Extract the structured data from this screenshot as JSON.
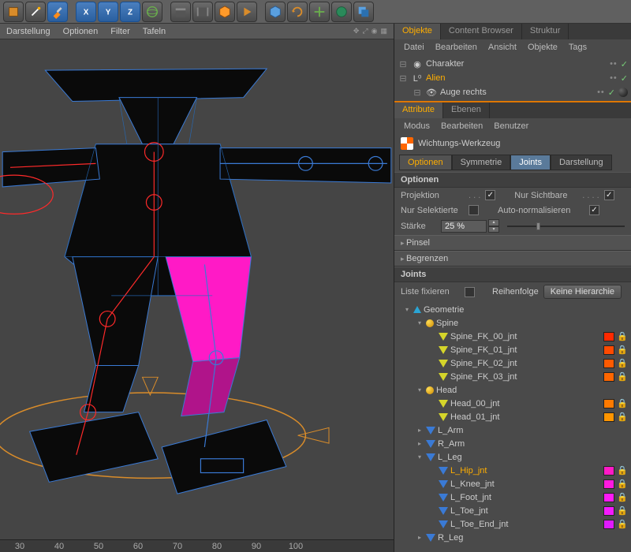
{
  "toolbar_icons": [
    "cube",
    "wand",
    "brush",
    "axis-x",
    "axis-y",
    "axis-z",
    "world",
    "clapper",
    "film",
    "orange-cube",
    "play",
    "blue-cube",
    "cycle",
    "arrows",
    "globe",
    "layers"
  ],
  "view_menu": {
    "items": [
      "Darstellung",
      "Optionen",
      "Filter",
      "Tafeln"
    ]
  },
  "ruler": [
    "30",
    "40",
    "50",
    "60",
    "70",
    "80",
    "90",
    "100"
  ],
  "right_tabs": {
    "items": [
      "Objekte",
      "Content Browser",
      "Struktur"
    ],
    "active": 0
  },
  "obj_menubar": [
    "Datei",
    "Bearbeiten",
    "Ansicht",
    "Objekte",
    "Tags"
  ],
  "object_manager": [
    {
      "indent": 0,
      "icon": "char",
      "label": "Charakter"
    },
    {
      "indent": 0,
      "icon": "null",
      "label": "Alien",
      "sel": true
    },
    {
      "indent": 1,
      "icon": "eye",
      "label": "Auge rechts",
      "material": true
    }
  ],
  "attr_tabs": {
    "items": [
      "Attribute",
      "Ebenen"
    ],
    "active": 0
  },
  "attr_menubar": [
    "Modus",
    "Bearbeiten",
    "Benutzer"
  ],
  "tool_name": "Wichtungs-Werkzeug",
  "mode_tabs": [
    "Optionen",
    "Symmetrie",
    "Joints",
    "Darstellung"
  ],
  "sections": {
    "options_hdr": "Optionen",
    "projection": "Projektion",
    "only_visible": "Nur Sichtbare",
    "only_selected": "Nur Selektierte",
    "auto_norm": "Auto-normalisieren",
    "strength": "Stärke",
    "strength_val": "25 %",
    "brush": "Pinsel",
    "limit": "Begrenzen",
    "joints_hdr": "Joints",
    "fix_list": "Liste fixieren",
    "order": "Reihenfolge",
    "order_btn": "Keine Hierarchie"
  },
  "joint_tree": [
    {
      "d": 0,
      "exp": "▾",
      "type": "geo",
      "label": "Geometrie"
    },
    {
      "d": 1,
      "exp": "▾",
      "type": "grp",
      "label": "Spine"
    },
    {
      "d": 2,
      "exp": "",
      "type": "bone-y",
      "label": "Spine_FK_00_jnt",
      "c": "#ff2a00"
    },
    {
      "d": 2,
      "exp": "",
      "type": "bone-y",
      "label": "Spine_FK_01_jnt",
      "c": "#ff4a00"
    },
    {
      "d": 2,
      "exp": "",
      "type": "bone-y",
      "label": "Spine_FK_02_jnt",
      "c": "#ff5a00"
    },
    {
      "d": 2,
      "exp": "",
      "type": "bone-y",
      "label": "Spine_FK_03_jnt",
      "c": "#ff6600"
    },
    {
      "d": 1,
      "exp": "▾",
      "type": "grp",
      "label": "Head"
    },
    {
      "d": 2,
      "exp": "",
      "type": "bone-y",
      "label": "Head_00_jnt",
      "c": "#ff7a00"
    },
    {
      "d": 2,
      "exp": "",
      "type": "bone-y",
      "label": "Head_01_jnt",
      "c": "#ff9500"
    },
    {
      "d": 1,
      "exp": "▸",
      "type": "bone-b",
      "label": "L_Arm"
    },
    {
      "d": 1,
      "exp": "▸",
      "type": "bone-b",
      "label": "R_Arm"
    },
    {
      "d": 1,
      "exp": "▾",
      "type": "bone-b",
      "label": "L_Leg"
    },
    {
      "d": 2,
      "exp": "",
      "type": "bone-b",
      "label": "L_Hip_jnt",
      "sel": true,
      "c": "#ff1ac6"
    },
    {
      "d": 2,
      "exp": "",
      "type": "bone-b",
      "label": "L_Knee_jnt",
      "c": "#ff1ae0"
    },
    {
      "d": 2,
      "exp": "",
      "type": "bone-b",
      "label": "L_Foot_jnt",
      "c": "#ff1af5"
    },
    {
      "d": 2,
      "exp": "",
      "type": "bone-b",
      "label": "L_Toe_jnt",
      "c": "#f51aff"
    },
    {
      "d": 2,
      "exp": "",
      "type": "bone-b",
      "label": "L_Toe_End_jnt",
      "c": "#e01aff"
    },
    {
      "d": 1,
      "exp": "▸",
      "type": "bone-b",
      "label": "R_Leg"
    }
  ]
}
